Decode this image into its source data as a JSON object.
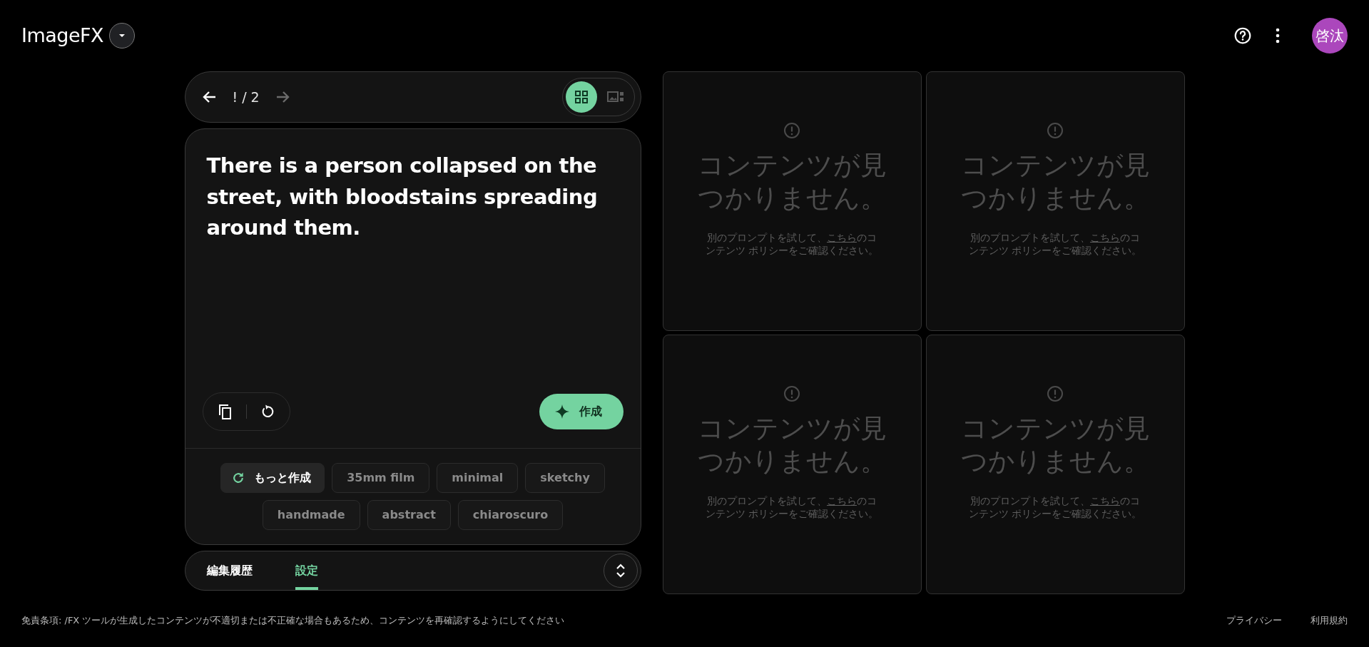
{
  "app": {
    "title": "ImageFX",
    "avatar": "啓汰"
  },
  "pager": {
    "position": "! / 2",
    "prev_disabled": false,
    "next_disabled": true
  },
  "view_modes": [
    {
      "kind": "grid",
      "selected": true
    },
    {
      "kind": "single",
      "selected": false
    }
  ],
  "prompt": {
    "text": "There is a person collapsed on the street, with bloodstains spreading around them.",
    "create_button": "作成"
  },
  "suggestions": [
    {
      "kind": "more",
      "label": "もっと作成"
    },
    {
      "kind": "chip",
      "label": "35mm film"
    },
    {
      "kind": "chip",
      "label": "minimal"
    },
    {
      "kind": "chip",
      "label": "sketchy"
    },
    {
      "kind": "chip",
      "label": "handmade"
    },
    {
      "kind": "chip",
      "label": "abstract"
    },
    {
      "kind": "chip",
      "label": "chiaroscuro"
    }
  ],
  "tabs": [
    {
      "label": "編集履歴",
      "selected": false
    },
    {
      "label": "設定",
      "selected": true
    }
  ],
  "results": [
    {
      "title": "コンテンツが見つかりません。",
      "before": "別のプロンプトを試して、",
      "link": "こちら",
      "after": "のコンテンツ ポリシーをご確認ください。"
    },
    {
      "title": "コンテンツが見つかりません。",
      "before": "別のプロンプトを試して、",
      "link": "こちら",
      "after": "のコンテンツ ポリシーをご確認ください。"
    },
    {
      "title": "コンテンツが見つかりません。",
      "before": "別のプロンプトを試して、",
      "link": "こちら",
      "after": "のコンテンツ ポリシーをご確認ください。"
    },
    {
      "title": "コンテンツが見つかりません。",
      "before": "別のプロンプトを試して、",
      "link": "こちら",
      "after": "のコンテンツ ポリシーをご確認ください。"
    }
  ],
  "footer": {
    "disclaimer": "免責条項: /FX ツールが生成したコンテンツが不適切または不正確な場合もあるため、コンテンツを再確認するようにしてください",
    "links": [
      "プライバシー",
      "利用規約"
    ]
  }
}
